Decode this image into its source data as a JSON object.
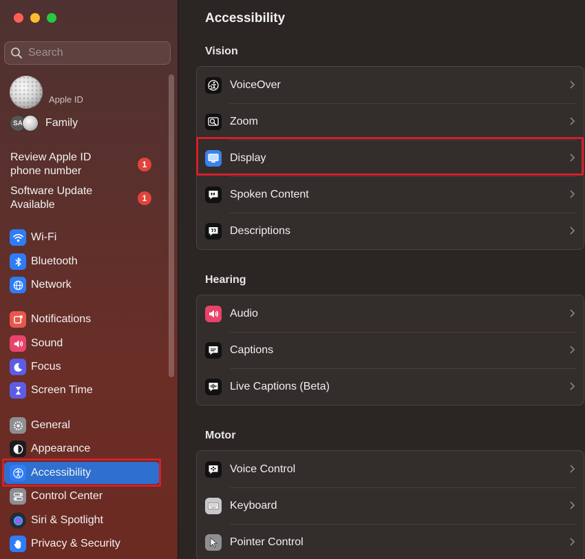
{
  "search": {
    "placeholder": "Search"
  },
  "account": {
    "apple_id_label": "Apple ID",
    "family_initials": "SA",
    "family_label": "Family"
  },
  "notices": [
    {
      "line1": "Review Apple ID",
      "line2": "phone number",
      "badge": "1"
    },
    {
      "line1": "Software Update",
      "line2": "Available",
      "badge": "1"
    }
  ],
  "sidebar": {
    "items": [
      {
        "label": "Wi-Fi",
        "icon": "wifi-icon",
        "color": "#2f7cf6"
      },
      {
        "label": "Bluetooth",
        "icon": "bluetooth-icon",
        "color": "#2f7cf6"
      },
      {
        "label": "Network",
        "icon": "globe-icon",
        "color": "#2f7cf6"
      },
      {
        "label": "Notifications",
        "icon": "bell-icon",
        "color": "#e8574c"
      },
      {
        "label": "Sound",
        "icon": "speaker-icon",
        "color": "#e8436a"
      },
      {
        "label": "Focus",
        "icon": "moon-icon",
        "color": "#5d5ce6"
      },
      {
        "label": "Screen Time",
        "icon": "hourglass-icon",
        "color": "#5d5ce6"
      },
      {
        "label": "General",
        "icon": "gear-icon",
        "color": "#8e8e93"
      },
      {
        "label": "Appearance",
        "icon": "appearance-icon",
        "color": "#1c1c1e"
      },
      {
        "label": "Accessibility",
        "icon": "accessibility-icon",
        "color": "#2f7cf6",
        "selected": true
      },
      {
        "label": "Control Center",
        "icon": "control-center-icon",
        "color": "#8e8e93"
      },
      {
        "label": "Siri & Spotlight",
        "icon": "siri-icon",
        "color": "#2a2a2e"
      },
      {
        "label": "Privacy & Security",
        "icon": "hand-icon",
        "color": "#2f7cf6"
      }
    ]
  },
  "main": {
    "title": "Accessibility",
    "sections": [
      {
        "title": "Vision",
        "rows": [
          {
            "label": "VoiceOver",
            "icon": "voiceover-icon"
          },
          {
            "label": "Zoom",
            "icon": "zoom-icon"
          },
          {
            "label": "Display",
            "icon": "display-icon"
          },
          {
            "label": "Spoken Content",
            "icon": "spoken-content-icon"
          },
          {
            "label": "Descriptions",
            "icon": "descriptions-icon"
          }
        ]
      },
      {
        "title": "Hearing",
        "rows": [
          {
            "label": "Audio",
            "icon": "audio-icon"
          },
          {
            "label": "Captions",
            "icon": "captions-icon"
          },
          {
            "label": "Live Captions (Beta)",
            "icon": "live-captions-icon"
          }
        ]
      },
      {
        "title": "Motor",
        "rows": [
          {
            "label": "Voice Control",
            "icon": "voice-control-icon"
          },
          {
            "label": "Keyboard",
            "icon": "keyboard-icon"
          },
          {
            "label": "Pointer Control",
            "icon": "pointer-control-icon"
          }
        ]
      }
    ]
  },
  "colors": {
    "accent": "#2e6fd0",
    "badge": "#e0453c",
    "annotation": "#d4202a"
  }
}
